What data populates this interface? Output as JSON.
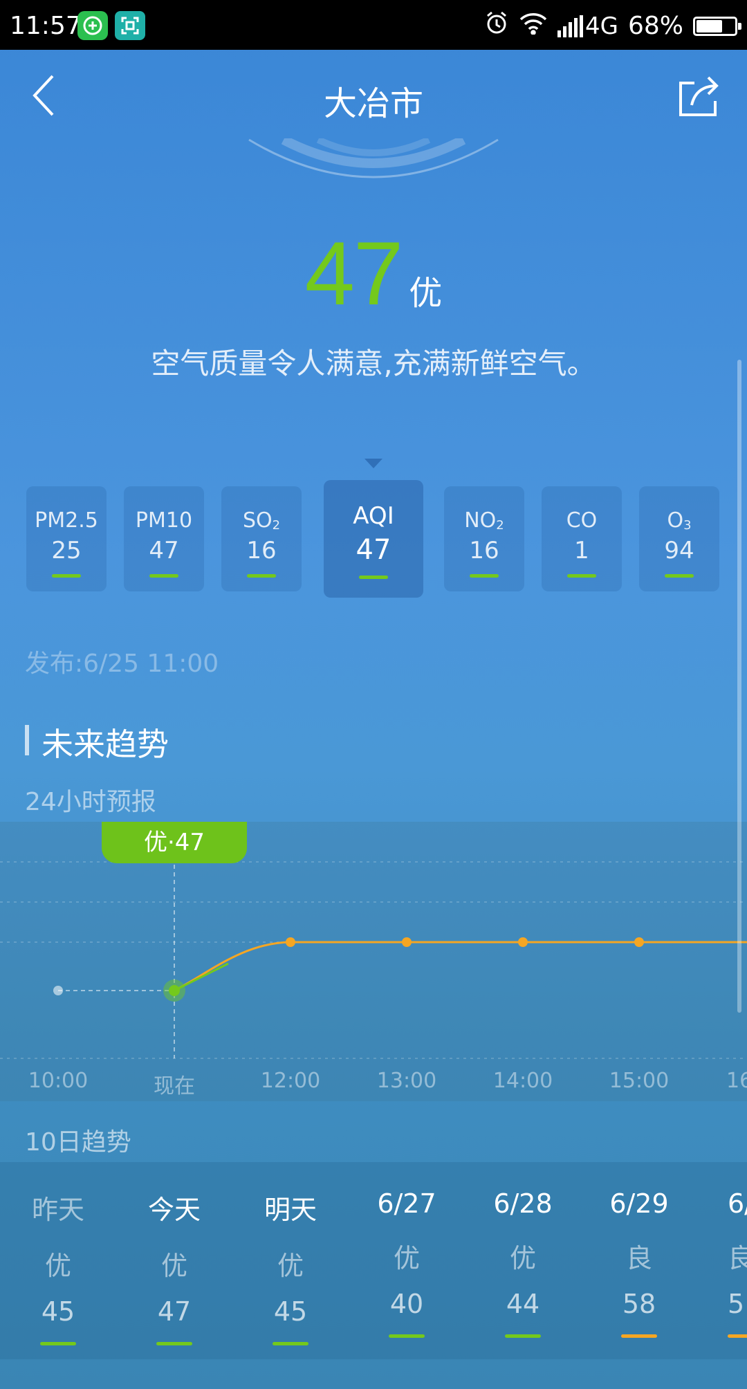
{
  "status_bar": {
    "time": "11:57",
    "network": "4G",
    "battery": "68%",
    "battery_level": 0.68
  },
  "header": {
    "title": "大冶市"
  },
  "aqi": {
    "value": "47",
    "level": "优",
    "description": "空气质量令人满意,充满新鲜空气。"
  },
  "pollutants": [
    {
      "name": "PM2.5",
      "value": "25",
      "color": "#74c91c"
    },
    {
      "name": "PM10",
      "value": "47",
      "color": "#74c91c"
    },
    {
      "name": "SO",
      "sub": "2",
      "value": "16",
      "color": "#74c91c"
    },
    {
      "name": "AQI",
      "value": "47",
      "color": "#74c91c",
      "active": true
    },
    {
      "name": "NO",
      "sub": "2",
      "value": "16",
      "color": "#74c91c"
    },
    {
      "name": "CO",
      "value": "1",
      "color": "#74c91c"
    },
    {
      "name": "O",
      "sub": "3",
      "value": "94",
      "color": "#74c91c"
    }
  ],
  "publish_time": "发布:6/25 11:00",
  "future": {
    "section_title": "未来趋势",
    "hourly_title": "24小时预报",
    "current_bubble": "优·47",
    "hours": [
      "10:00",
      "现在",
      "12:00",
      "13:00",
      "14:00",
      "15:00",
      "16"
    ]
  },
  "ten_day": {
    "title": "10日趋势",
    "days": [
      {
        "name": "昨天",
        "level": "优",
        "value": "45",
        "color": "#74c91c"
      },
      {
        "name": "今天",
        "level": "优",
        "value": "47",
        "color": "#74c91c"
      },
      {
        "name": "明天",
        "level": "优",
        "value": "45",
        "color": "#74c91c"
      },
      {
        "name": "6/27",
        "level": "优",
        "value": "40",
        "color": "#74c91c"
      },
      {
        "name": "6/28",
        "level": "优",
        "value": "44",
        "color": "#74c91c"
      },
      {
        "name": "6/29",
        "level": "良",
        "value": "58",
        "color": "#f5a623"
      },
      {
        "name": "6/",
        "level": "良",
        "value": "5",
        "color": "#f5a623"
      }
    ]
  },
  "colors": {
    "good": "#74c91c",
    "moderate": "#f5a623",
    "line": "#f5a623"
  }
}
